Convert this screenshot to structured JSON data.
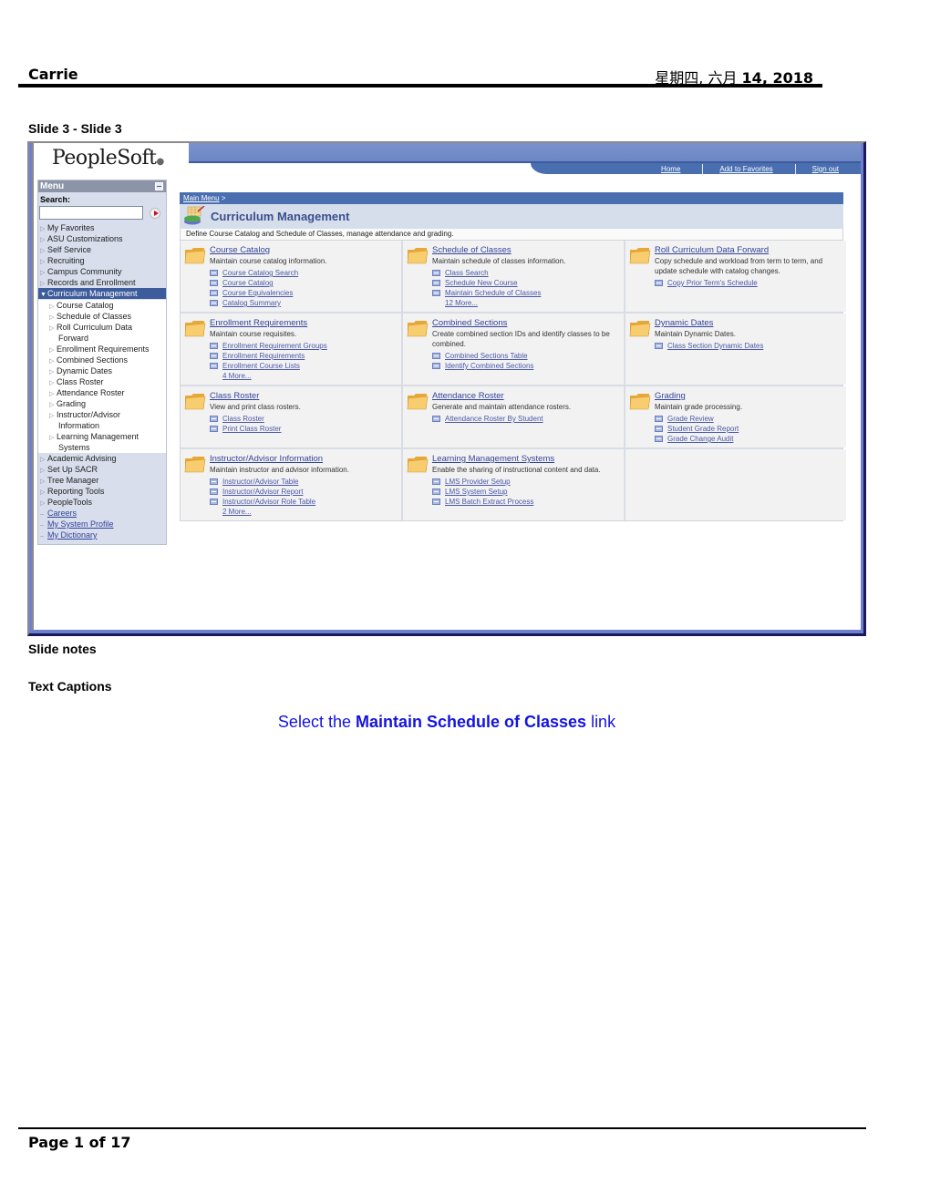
{
  "doc_header": {
    "author": "Carrie",
    "date_prefix": "星期四, 六月",
    "date_bold": "14, 2018"
  },
  "slide_title": "Slide 3 - Slide 3",
  "screenshot": {
    "logo": "PeopleSoft",
    "nav_links": [
      "Home",
      "Add to Favorites",
      "Sign out"
    ],
    "menu": {
      "header": "Menu",
      "search_label": "Search:",
      "search_value": "",
      "items_top": [
        "My Favorites",
        "ASU Customizations",
        "Self Service",
        "Recruiting",
        "Campus Community",
        "Records and Enrollment"
      ],
      "active_item": "Curriculum Management",
      "sub_items": [
        {
          "label": "Course Catalog"
        },
        {
          "label": "Schedule of Classes"
        },
        {
          "label": "Roll Curriculum Data",
          "cont": "Forward"
        },
        {
          "label": "Enrollment Requirements"
        },
        {
          "label": "Combined Sections"
        },
        {
          "label": "Dynamic Dates"
        },
        {
          "label": "Class Roster"
        },
        {
          "label": "Attendance Roster"
        },
        {
          "label": "Grading"
        },
        {
          "label": "Instructor/Advisor",
          "cont": "Information"
        },
        {
          "label": "Learning Management",
          "cont": "Systems"
        }
      ],
      "items_bottom": [
        "Academic Advising",
        "Set Up SACR",
        "Tree Manager",
        "Reporting Tools",
        "PeopleTools"
      ],
      "links": [
        "Careers",
        "My System Profile",
        "My Dictionary"
      ]
    },
    "breadcrumb": {
      "link": "Main Menu",
      "separator": ">"
    },
    "page_title": "Curriculum Management",
    "page_description": "Define Course Catalog and Schedule of Classes, manage attendance and grading.",
    "sections": [
      {
        "title": "Course Catalog",
        "description": "Maintain course catalog information.",
        "links": [
          "Course Catalog Search",
          "Course Catalog",
          "Course Equivalencies",
          "Catalog Summary"
        ],
        "more": ""
      },
      {
        "title": "Schedule of Classes",
        "description": "Maintain schedule of classes information.",
        "links": [
          "Class Search",
          "Schedule New Course",
          "Maintain Schedule of Classes"
        ],
        "more": "12 More..."
      },
      {
        "title": "Roll Curriculum Data Forward",
        "description": "Copy schedule and workload from term to term, and update schedule with catalog changes.",
        "links": [
          "Copy Prior Term's Schedule"
        ],
        "more": ""
      },
      {
        "title": "Enrollment Requirements",
        "description": "Maintain course requisites.",
        "links": [
          "Enrollment Requirement Groups",
          "Enrollment Requirements",
          "Enrollment Course Lists"
        ],
        "more": "4 More..."
      },
      {
        "title": "Combined Sections",
        "description": "Create combined section IDs and identify classes to be combined.",
        "links": [
          "Combined Sections Table",
          "Identify Combined Sections"
        ],
        "more": ""
      },
      {
        "title": "Dynamic Dates",
        "description": "Maintain Dynamic Dates.",
        "links": [
          "Class Section Dynamic Dates"
        ],
        "more": ""
      },
      {
        "title": "Class Roster",
        "description": "View and print class rosters.",
        "links": [
          "Class Roster",
          "Print Class Roster"
        ],
        "more": ""
      },
      {
        "title": "Attendance Roster",
        "description": "Generate and maintain attendance rosters.",
        "links": [
          "Attendance Roster By Student"
        ],
        "more": ""
      },
      {
        "title": "Grading",
        "description": "Maintain grade processing.",
        "links": [
          "Grade Review",
          "Student Grade Report",
          "Grade Change Audit"
        ],
        "more": ""
      },
      {
        "title": "Instructor/Advisor Information",
        "description": "Maintain instructor and advisor information.",
        "links": [
          "Instructor/Advisor Table",
          "Instructor/Advisor Report",
          "Instructor/Advisor Role Table"
        ],
        "more": "2 More..."
      },
      {
        "title": "Learning Management Systems",
        "description": "Enable the sharing of instructional content and data.",
        "links": [
          "LMS Provider Setup",
          "LMS System Setup",
          "LMS Batch Extract Process"
        ],
        "more": ""
      }
    ]
  },
  "slide_notes_label": "Slide notes",
  "text_captions_label": "Text Captions",
  "caption": {
    "prefix": "Select the ",
    "bold": "Maintain Schedule of Classes",
    "suffix": " link",
    "color": "#1414e0"
  },
  "footer": {
    "page_label": "Page 1 of 17"
  }
}
